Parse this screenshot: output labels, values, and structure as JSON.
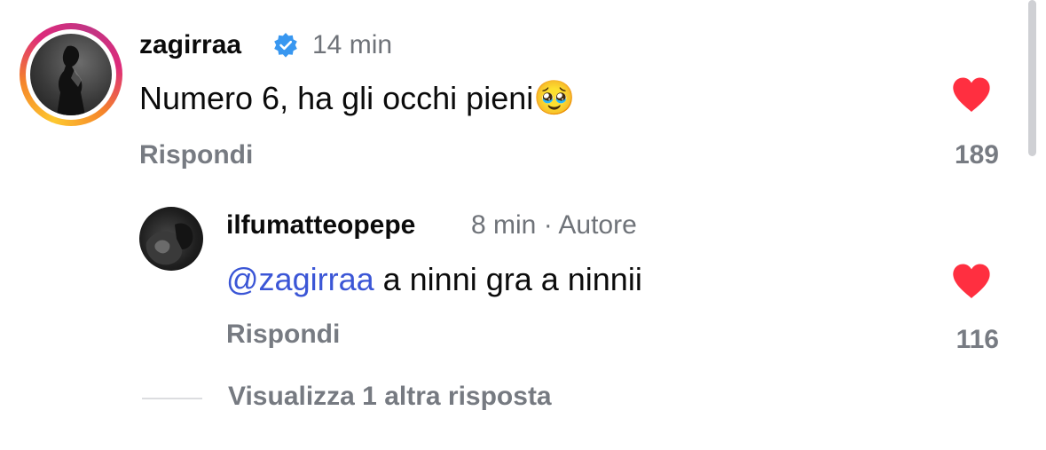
{
  "comment": {
    "username": "zagirraa",
    "verified_icon": "verified-badge-icon",
    "time": "14 min",
    "text": "Numero 6, ha gli occhi pieni",
    "emoji": "🥹",
    "reply_label": "Rispondi",
    "like_count": "189",
    "like_icon": "heart-icon",
    "like_color": "#ff2f40"
  },
  "reply": {
    "username": "ilfumatteopepe",
    "time": "8 min",
    "separator": "·",
    "author_badge": "Autore",
    "mention": "@zagirraa",
    "text": "a ninni gra a ninnii",
    "reply_label": "Rispondi",
    "like_count": "116",
    "like_icon": "heart-icon"
  },
  "view_more": {
    "label": "Visualizza 1 altra risposta"
  },
  "colors": {
    "mention": "#3b56d6",
    "secondary_text": "#777b82",
    "verified": "#3897f0"
  }
}
